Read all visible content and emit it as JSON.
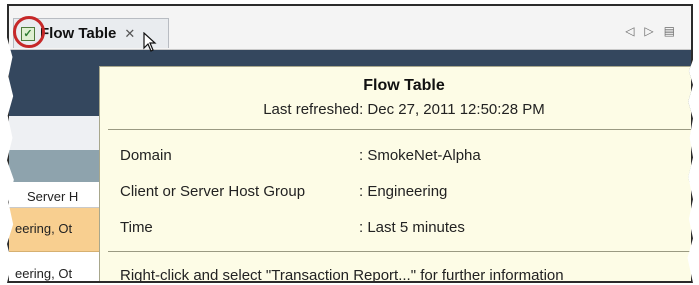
{
  "tab": {
    "label": "Flow Table",
    "close_glyph": "✕"
  },
  "tab_nav": {
    "prev": "◁",
    "next": "▷",
    "menu": "▤"
  },
  "table": {
    "column_header": "Server H",
    "rows": [
      "eering, Ot",
      "eering, Ot"
    ]
  },
  "tooltip": {
    "title": "Flow Table",
    "last_refreshed": "Last refreshed: Dec 27, 2011 12:50:28 PM",
    "rows": [
      {
        "key": "Domain",
        "value": ": SmokeNet-Alpha"
      },
      {
        "key": "Client or Server Host Group",
        "value": ": Engineering"
      },
      {
        "key": "Time",
        "value": ": Last 5 minutes"
      }
    ],
    "footer": "Right-click and select \"Transaction Report...\" for further information"
  },
  "colors": {
    "header_blue": "#34475e",
    "highlight_ring": "#c62828",
    "tooltip_bg": "#fdfce6",
    "orange_cell": "#f8cf90"
  }
}
